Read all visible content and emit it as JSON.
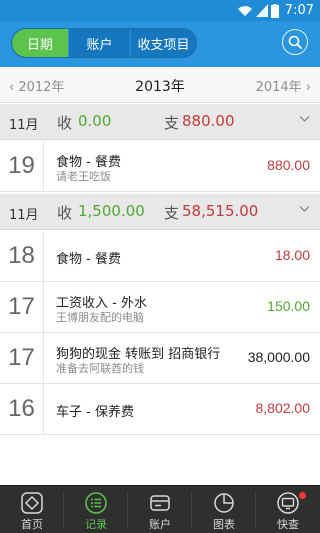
{
  "status_bar": {
    "time": "7:07"
  },
  "header": {
    "tabs": [
      {
        "label": "日期",
        "active": true
      },
      {
        "label": "账户",
        "active": false
      },
      {
        "label": "收支项目",
        "active": false
      }
    ],
    "search_icon": "search-icon"
  },
  "year_bar": {
    "prev": "‹ 2012年",
    "current": "2013年",
    "next": "2014年 ›"
  },
  "months": [
    {
      "month": "11月",
      "income_label": "收",
      "income": "0.00",
      "expense_label": "支",
      "expense": "880.00",
      "records": [
        {
          "day": "19",
          "title": "食物 - 餐费",
          "note": "请老王吃饭",
          "amount": "880.00",
          "type": "expense"
        }
      ]
    },
    {
      "month": "11月",
      "income_label": "收",
      "income": "1,500.00",
      "expense_label": "支",
      "expense": "58,515.00",
      "records": [
        {
          "day": "18",
          "title": "食物 - 餐费",
          "note": "",
          "amount": "18.00",
          "type": "expense"
        },
        {
          "day": "17",
          "title": "工资收入 - 外水",
          "note": "王博朋友配的电脑",
          "amount": "150.00",
          "type": "income"
        },
        {
          "day": "17",
          "title": "狗狗的现金 转账到 招商银行",
          "note": "准备去阿联酋的钱",
          "amount": "38,000.00",
          "type": "transfer"
        },
        {
          "day": "16",
          "title": "车子 - 保养费",
          "note": "",
          "amount": "8,802.00",
          "type": "expense"
        }
      ]
    }
  ],
  "bottom_nav": [
    {
      "label": "首页",
      "icon": "home-icon",
      "active": false
    },
    {
      "label": "记录",
      "icon": "list-icon",
      "active": true
    },
    {
      "label": "账户",
      "icon": "wallet-icon",
      "active": false
    },
    {
      "label": "图表",
      "icon": "pie-chart-icon",
      "active": false
    },
    {
      "label": "快查",
      "icon": "monitor-icon",
      "active": false,
      "badge": true
    }
  ],
  "colors": {
    "header_blue": "#2a96df",
    "active_green": "#5cc44d",
    "income_green": "#4fa930",
    "expense_red": "#c23b3b"
  }
}
